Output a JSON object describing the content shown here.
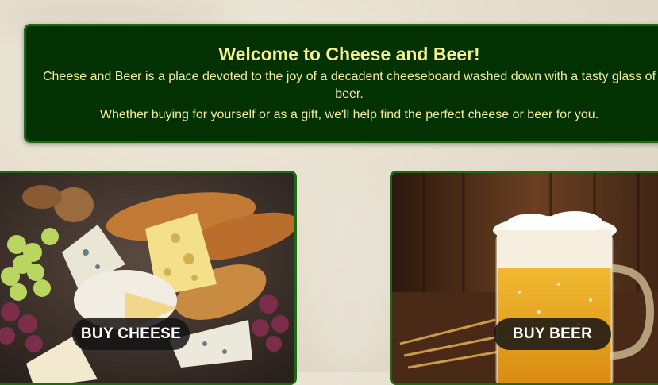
{
  "welcome": {
    "title": "Welcome to Cheese and Beer!",
    "intro": "Cheese and Beer is a place devoted to the joy of a decadent cheeseboard washed down with a tasty glass of beer.",
    "subtext": "Whether buying for yourself or as a gift, we'll help find the perfect cheese or beer for you."
  },
  "cards": {
    "cheese": {
      "button_label": "BUY CHEESE"
    },
    "beer": {
      "button_label": "BUY BEER"
    }
  },
  "colors": {
    "panel_bg": "#023102",
    "panel_border": "#1d6a12",
    "heading_text": "#f6f08c",
    "button_bg": "#141414"
  }
}
